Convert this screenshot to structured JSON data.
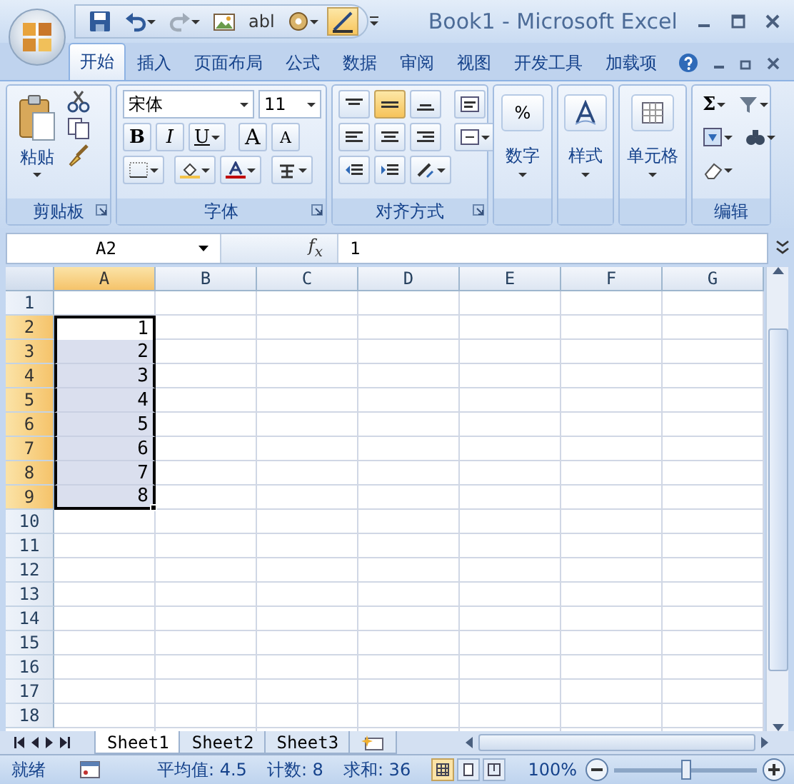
{
  "window": {
    "title": "Book1 - Microsoft Excel"
  },
  "quick_access": [
    {
      "kind": "save"
    },
    {
      "kind": "undo"
    },
    {
      "kind": "redo"
    },
    {
      "kind": "picture"
    },
    {
      "kind": "textfield",
      "label": "abl"
    },
    {
      "kind": "control"
    },
    {
      "kind": "design",
      "selected": true
    }
  ],
  "tabs": [
    {
      "label": "开始",
      "selected": true
    },
    {
      "label": "插入",
      "selected": false
    },
    {
      "label": "页面布局",
      "selected": false
    },
    {
      "label": "公式",
      "selected": false
    },
    {
      "label": "数据",
      "selected": false
    },
    {
      "label": "审阅",
      "selected": false
    },
    {
      "label": "视图",
      "selected": false
    },
    {
      "label": "开发工具",
      "selected": false
    },
    {
      "label": "加载项",
      "selected": false
    }
  ],
  "ribbon": {
    "groups": [
      {
        "kind": "clipboard",
        "label": "剪贴板",
        "launcher": true,
        "paste": "粘贴"
      },
      {
        "kind": "font",
        "label": "字体",
        "launcher": true,
        "font_name": "宋体",
        "font_size": "11",
        "format_buttons": [
          "B",
          "I",
          "U"
        ],
        "grow": "A",
        "shrink": "A"
      },
      {
        "kind": "alignment",
        "label": "对齐方式",
        "launcher": true,
        "vertical_buttons": [
          {
            "selected": false
          },
          {
            "selected": true
          },
          {
            "selected": false
          }
        ]
      },
      {
        "kind": "number",
        "label": "数字",
        "launcher": false,
        "symbol": "%"
      },
      {
        "kind": "styles",
        "label": "样式",
        "launcher": false
      },
      {
        "kind": "cells",
        "label": "单元格",
        "launcher": false
      },
      {
        "kind": "editing",
        "label": "编辑",
        "launcher": false,
        "sum": "Σ"
      }
    ]
  },
  "formula_bar": {
    "name_box": "A2",
    "function_label": "f$_{x}$",
    "value": "1"
  },
  "columns": [
    {
      "label": "A",
      "selected": true
    },
    {
      "label": "B",
      "selected": false
    },
    {
      "label": "C",
      "selected": false
    },
    {
      "label": "D",
      "selected": false
    },
    {
      "label": "E",
      "selected": false
    },
    {
      "label": "F",
      "selected": false
    },
    {
      "label": "G",
      "selected": false
    }
  ],
  "rows": [
    {
      "label": "1",
      "selected": false,
      "active": false
    },
    {
      "label": "2",
      "selected": true,
      "active": true,
      "cells": [
        "1"
      ]
    },
    {
      "label": "3",
      "selected": true,
      "active": false,
      "cells": [
        "2"
      ]
    },
    {
      "label": "4",
      "selected": true,
      "active": false,
      "cells": [
        "3"
      ]
    },
    {
      "label": "5",
      "selected": true,
      "active": false,
      "cells": [
        "4"
      ]
    },
    {
      "label": "6",
      "selected": true,
      "active": false,
      "cells": [
        "5"
      ]
    },
    {
      "label": "7",
      "selected": true,
      "active": false,
      "cells": [
        "6"
      ]
    },
    {
      "label": "8",
      "selected": true,
      "active": false,
      "cells": [
        "7"
      ]
    },
    {
      "label": "9",
      "selected": true,
      "active": false,
      "cells": [
        "8"
      ]
    },
    {
      "label": "10",
      "selected": false,
      "active": false
    },
    {
      "label": "11",
      "selected": false,
      "active": false
    },
    {
      "label": "12",
      "selected": false,
      "active": false
    },
    {
      "label": "13",
      "selected": false,
      "active": false
    },
    {
      "label": "14",
      "selected": false,
      "active": false
    },
    {
      "label": "15",
      "selected": false,
      "active": false
    },
    {
      "label": "16",
      "selected": false,
      "active": false
    },
    {
      "label": "17",
      "selected": false,
      "active": false
    },
    {
      "label": "18",
      "selected": false,
      "active": false
    }
  ],
  "sheet_tabs": [
    {
      "label": "Sheet1",
      "selected": true
    },
    {
      "label": "Sheet2",
      "selected": false
    },
    {
      "label": "Sheet3",
      "selected": false
    }
  ],
  "status_bar": {
    "status": "就绪",
    "average": "平均值: 4.5",
    "count": "计数: 8",
    "sum": "求和: 36",
    "views": [
      {
        "selected": true
      },
      {
        "selected": false
      },
      {
        "selected": false
      }
    ],
    "zoom": "100%",
    "zoom_level": {
      "level": 0.5
    }
  }
}
